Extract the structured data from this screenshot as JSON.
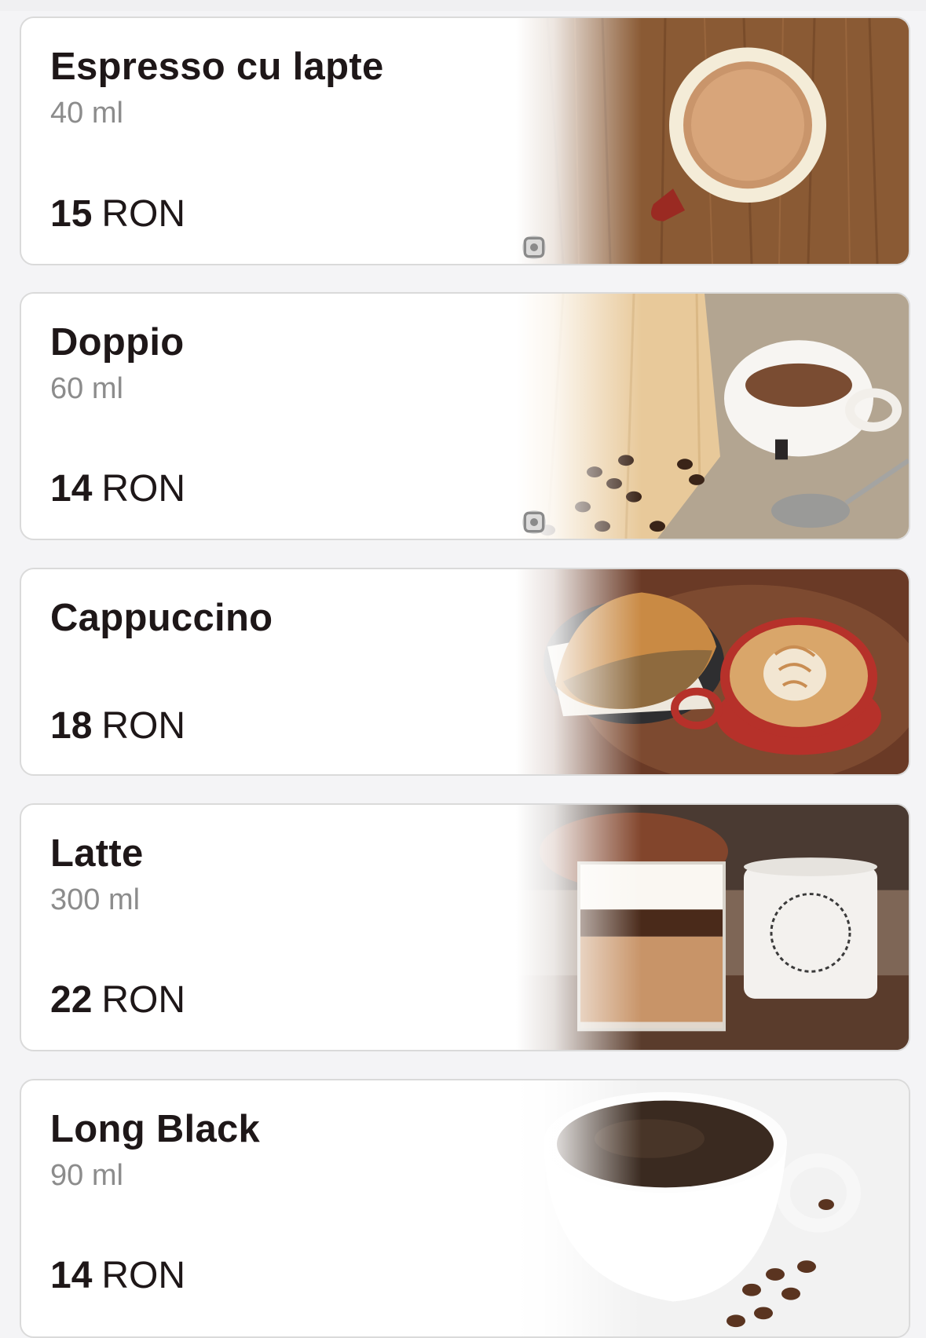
{
  "menu": {
    "items": [
      {
        "name": "Espresso cu lapte",
        "volume": "40 ml",
        "price": "15",
        "currency": "RON",
        "image": "espresso-with-milk-cup-photo"
      },
      {
        "name": "Doppio",
        "volume": "60 ml",
        "price": "14",
        "currency": "RON",
        "image": "doppio-cup-photo"
      },
      {
        "name": "Cappuccino",
        "volume": "",
        "price": "18",
        "currency": "RON",
        "image": "cappuccino-croissant-photo"
      },
      {
        "name": "Latte",
        "volume": "300 ml",
        "price": "22",
        "currency": "RON",
        "image": "latte-glass-photo"
      },
      {
        "name": "Long Black",
        "volume": "90 ml",
        "price": "14",
        "currency": "RON",
        "image": "long-black-cup-photo"
      }
    ]
  },
  "colors": {
    "text_primary": "#1e1718",
    "text_secondary": "#8c8c8c",
    "card_border": "#dadada"
  }
}
